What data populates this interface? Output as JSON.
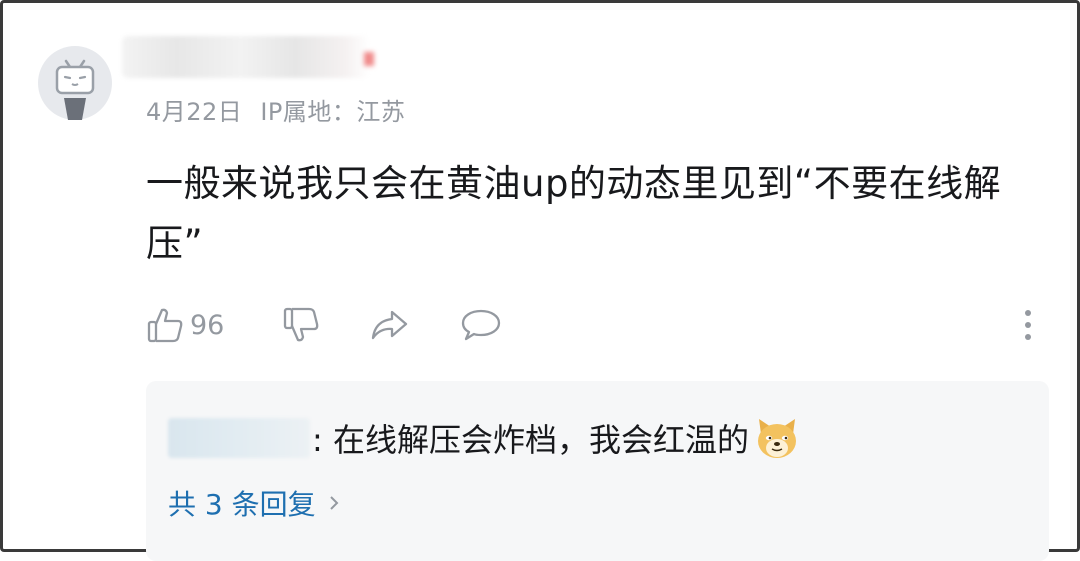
{
  "comment": {
    "avatar_icon": "bilibili-tv-icon",
    "date": "4月22日",
    "ip_location": "IP属地：江苏",
    "text": "一般来说我只会在黄油up的动态里见到“不要在线解压”",
    "like_count": "96"
  },
  "actions": {
    "like_icon": "thumbs-up-icon",
    "dislike_icon": "thumbs-down-icon",
    "share_icon": "share-icon",
    "reply_icon": "comment-icon",
    "more_icon": "more-vertical-icon"
  },
  "reply_preview": {
    "text": ": 在线解压会炸档，我会红温的",
    "emoji": "doge-emoji",
    "more_replies_label": "共 3 条回复"
  },
  "colors": {
    "meta": "#9499a0",
    "text": "#18191c",
    "link": "#1e6fb0",
    "reply_bg": "#f6f7f8"
  }
}
